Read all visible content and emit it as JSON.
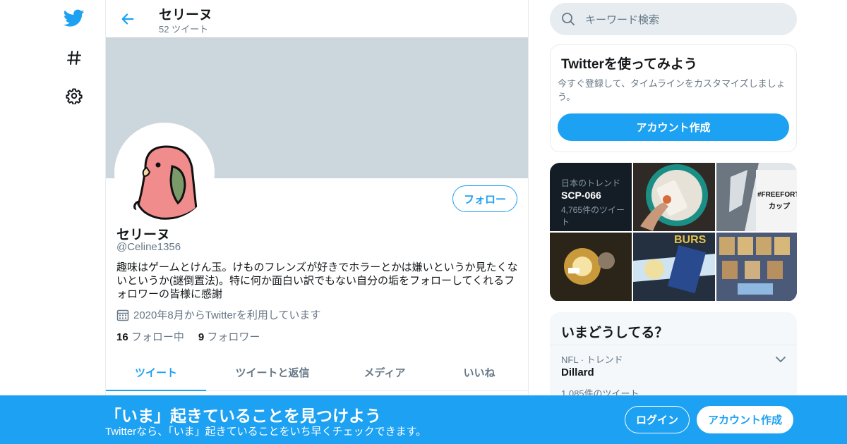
{
  "colors": {
    "accent": "#1da1f2",
    "banner": "#ccd6dd",
    "muted_text": "#657786",
    "border": "#e6ecf0"
  },
  "nav": {
    "icons": [
      "twitter-bird-icon",
      "hashtag-icon",
      "gear-icon"
    ]
  },
  "header": {
    "name": "セリーヌ",
    "tweet_count": "52 ツイート"
  },
  "profile": {
    "follow_label": "フォロー",
    "name": "セリーヌ",
    "handle": "@Celine1356",
    "bio": "趣味はゲームとけん玉。けものフレンズが好きでホラーとかは嫌いというか見たくないというか(謎倒置法)。特に何か面白い訳でもない自分の垢をフォローしてくれるフォロワーの皆様に感謝",
    "joined": "2020年8月からTwitterを利用しています",
    "following_count": "16",
    "following_label": "フォロー中",
    "followers_count": "9",
    "followers_label": "フォロワー"
  },
  "tabs": [
    {
      "label": "ツイート",
      "active": true
    },
    {
      "label": "ツイートと返信",
      "active": false
    },
    {
      "label": "メディア",
      "active": false
    },
    {
      "label": "いいね",
      "active": false
    }
  ],
  "search": {
    "placeholder": "キーワード検索"
  },
  "signup_card": {
    "title": "Twitterを使ってみよう",
    "description": "今すぐ登録して、タイムラインをカスタマイズしましょう。",
    "button": "アカウント作成"
  },
  "trend_media": {
    "label": "日本のトレンド",
    "topic": "SCP-066",
    "count": "4,765件のツイート",
    "fortnite_title": "#FREEFORTNITE",
    "fortnite_sub": "カップ",
    "burst_text": "BURS"
  },
  "whats_happening": {
    "title": "いまどうしてる？",
    "trend_meta": "NFL · トレンド",
    "trend_name": "Dillard",
    "trend_count": "1,085件のツイート"
  },
  "bottom_bar": {
    "title": "「いま」起きていることを見つけよう",
    "subtitle": "Twitterなら、「いま」起きていることをいち早くチェックできます。",
    "login": "ログイン",
    "create_account": "アカウント作成"
  }
}
